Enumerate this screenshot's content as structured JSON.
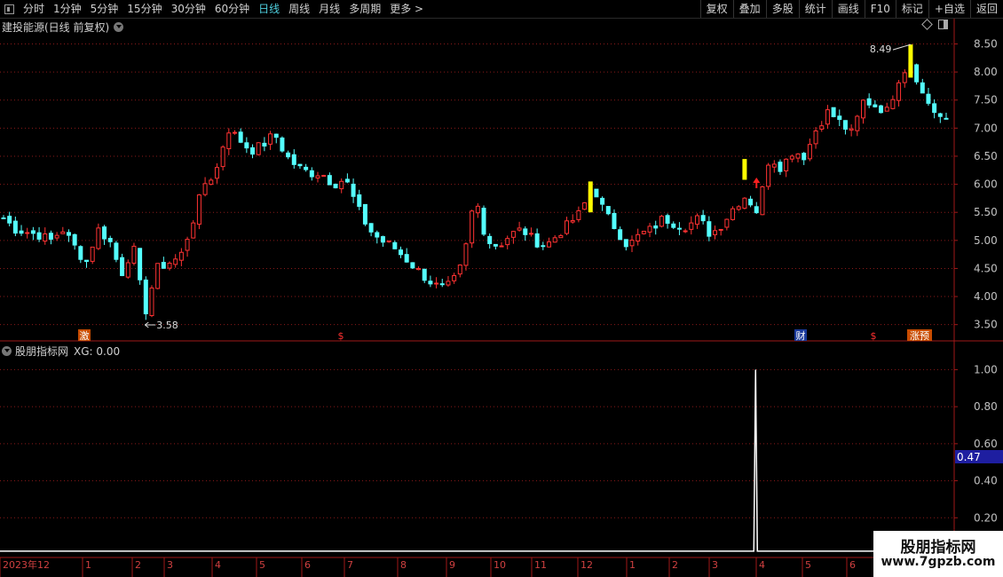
{
  "toolbar": {
    "periods": [
      "分时",
      "1分钟",
      "5分钟",
      "15分钟",
      "30分钟",
      "60分钟",
      "日线",
      "周线",
      "月线",
      "多周期",
      "更多 >"
    ],
    "active_period": "日线",
    "right_buttons": [
      "复权",
      "叠加",
      "多股",
      "统计",
      "画线",
      "F10",
      "标记",
      "+自选",
      "返回"
    ]
  },
  "main_chart": {
    "title": "建投能源(日线 前复权)"
  },
  "indicator_panel": {
    "label": "股朋指标网",
    "value_text": "XG: 0.00",
    "current_value_badge": "0.47"
  },
  "watermark": {
    "line1": "股朋指标网",
    "line2": "www.7gpzb.com"
  },
  "colors": {
    "up": "#ff3232",
    "down": "#54ffff",
    "signal": "#ffff00",
    "grid": "#8b1a1a",
    "axis_text": "#c0c0c0",
    "badge_bg": "#1e1ea0"
  },
  "chart_data": [
    {
      "type": "candlestick",
      "title": "建投能源(日线 前复权)",
      "y_ticks": [
        "3.50",
        "4.00",
        "4.50",
        "5.00",
        "5.50",
        "6.00",
        "6.50",
        "7.00",
        "7.50",
        "8.00",
        "8.50"
      ],
      "ylim": [
        3.4,
        8.65
      ],
      "grid": true,
      "x_labels": [
        "2023年12",
        "1",
        "2",
        "3",
        "4",
        "5",
        "6",
        "7",
        "8",
        "9",
        "10",
        "11",
        "12",
        "1",
        "2",
        "3",
        "4",
        "5",
        "6"
      ],
      "annotations": [
        {
          "text": "3.58",
          "type": "low_marker"
        },
        {
          "text": "8.49",
          "type": "high_marker"
        }
      ],
      "event_badges": [
        {
          "text": "激",
          "kind": "orange"
        },
        {
          "text": "$",
          "kind": "dollar"
        },
        {
          "text": "财",
          "kind": "blue"
        },
        {
          "text": "$",
          "kind": "dollar"
        },
        {
          "text": "涨预",
          "kind": "orange"
        }
      ],
      "signal_arrow": "up",
      "close_path": [
        5.4,
        5.2,
        5.15,
        5.1,
        5.0,
        5.2,
        4.9,
        4.6,
        5.2,
        5.0,
        4.4,
        4.9,
        3.7,
        4.5,
        4.6,
        4.7,
        5.3,
        6.0,
        6.2,
        7.0,
        6.8,
        6.6,
        6.7,
        6.9,
        6.5,
        6.3,
        6.2,
        6.2,
        6.0,
        6.1,
        5.6,
        5.2,
        5.0,
        4.9,
        4.7,
        4.5,
        4.3,
        4.15,
        4.2,
        4.6,
        5.8,
        5.0,
        4.9,
        5.1,
        5.2,
        5.0,
        4.9,
        5.1,
        5.3,
        5.5,
        6.0,
        5.5,
        5.2,
        4.9,
        5.1,
        5.2,
        5.4,
        5.3,
        5.25,
        5.4,
        5.1,
        5.3,
        5.6,
        5.8,
        5.5,
        6.5,
        6.3,
        6.6,
        6.5,
        7.0,
        7.3,
        7.1,
        6.9,
        7.5,
        7.4,
        7.3,
        7.9,
        8.2,
        7.6,
        7.3,
        7.1
      ],
      "highlights": [
        {
          "index": 50,
          "low": 5.5,
          "high": 6.05
        },
        {
          "index": 63,
          "low": 6.08,
          "high": 6.45
        },
        {
          "index": 77,
          "low": 7.9,
          "high": 8.49
        }
      ]
    },
    {
      "type": "line",
      "series": [
        {
          "name": "XG",
          "spike_index": 64,
          "peak": 1.0
        }
      ],
      "y_ticks": [
        "0.20",
        "0.40",
        "0.60",
        "0.80",
        "1.00"
      ],
      "ylim": [
        0,
        1.05
      ],
      "grid": true
    }
  ]
}
